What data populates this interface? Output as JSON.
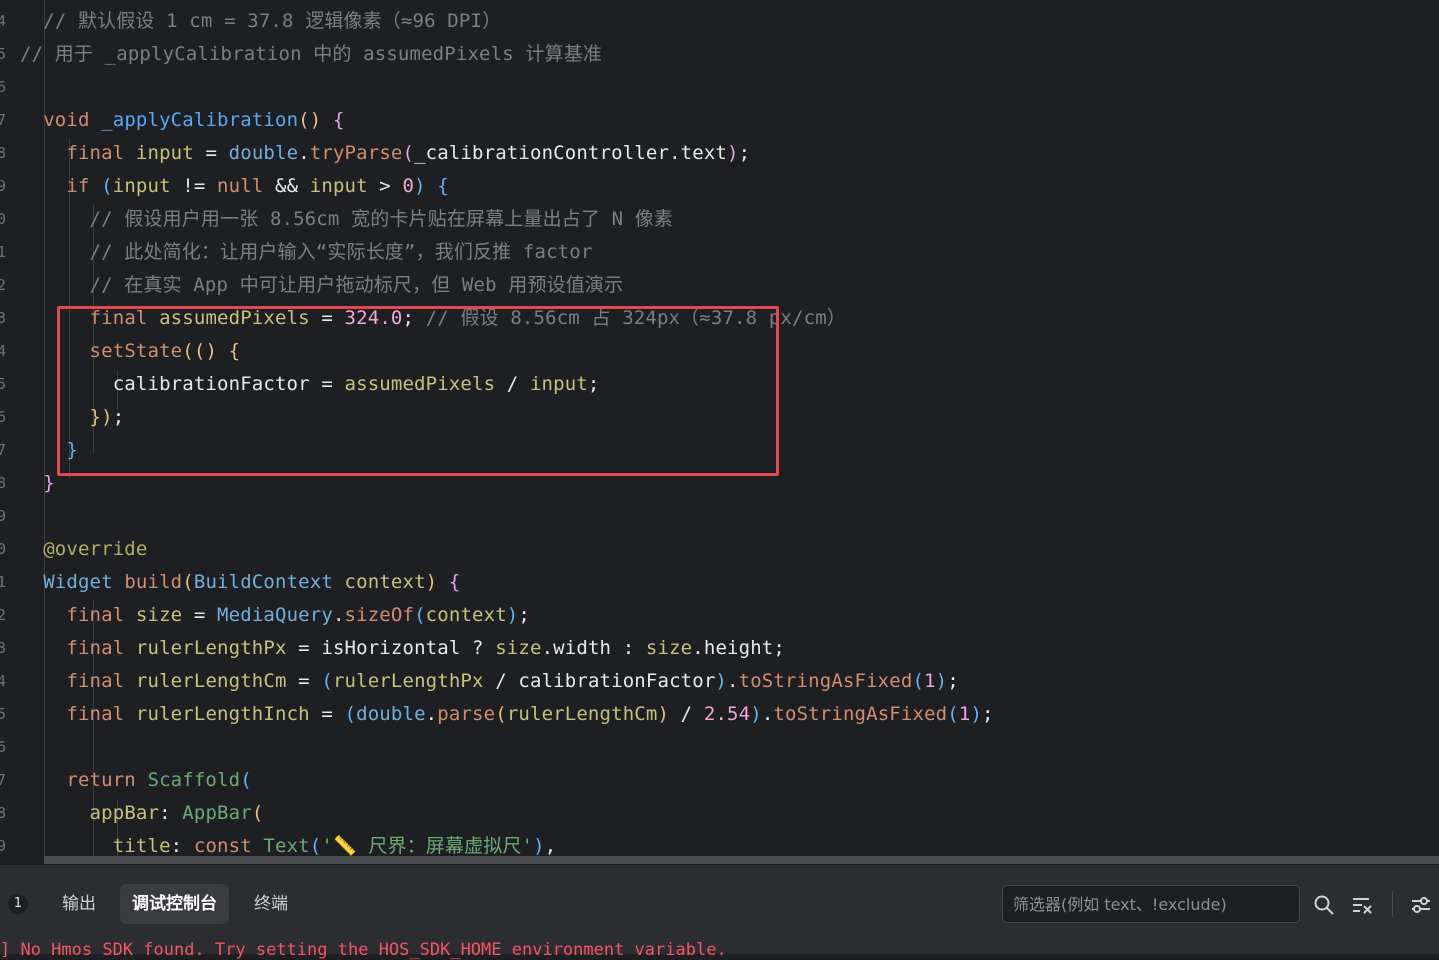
{
  "editor": {
    "gutter_numbers": [
      "4",
      "5",
      "6",
      "7",
      "8",
      "9",
      "0",
      "1",
      "2",
      "3",
      "4",
      "5",
      "6",
      "7",
      "8",
      "9",
      "0",
      "1",
      "2",
      "3",
      "4",
      "5",
      "6",
      "7",
      "8",
      "9"
    ],
    "lines": [
      [
        {
          "t": "  // 默认假设 1 cm = 37.8 逻辑像素（≈96 DPI）",
          "c": "comment"
        }
      ],
      [
        {
          "t": "// 用于 _applyCalibration 中的 assumedPixels 计算基准",
          "c": "comment"
        }
      ],
      [],
      [
        {
          "t": "  ",
          "c": "plain"
        },
        {
          "t": "void ",
          "c": "kw"
        },
        {
          "t": "_applyCalibration",
          "c": "fn"
        },
        {
          "t": "() ",
          "c": "brace3"
        },
        {
          "t": "{",
          "c": "brace1"
        }
      ],
      [
        {
          "t": "    ",
          "c": "plain"
        },
        {
          "t": "final ",
          "c": "kw"
        },
        {
          "t": "input",
          "c": "var"
        },
        {
          "t": " = ",
          "c": "plain"
        },
        {
          "t": "double",
          "c": "type"
        },
        {
          "t": ".",
          "c": "plain"
        },
        {
          "t": "tryParse",
          "c": "kw"
        },
        {
          "t": "(",
          "c": "brace1"
        },
        {
          "t": "_calibrationController",
          "c": "plain"
        },
        {
          "t": ".",
          "c": "plain"
        },
        {
          "t": "text",
          "c": "plain"
        },
        {
          "t": ")",
          "c": "brace1"
        },
        {
          "t": ";",
          "c": "plain"
        }
      ],
      [
        {
          "t": "    ",
          "c": "plain"
        },
        {
          "t": "if ",
          "c": "kw"
        },
        {
          "t": "(",
          "c": "brace2"
        },
        {
          "t": "input",
          "c": "var"
        },
        {
          "t": " != ",
          "c": "plain"
        },
        {
          "t": "null",
          "c": "kw"
        },
        {
          "t": " && ",
          "c": "plain"
        },
        {
          "t": "input",
          "c": "var"
        },
        {
          "t": " > ",
          "c": "plain"
        },
        {
          "t": "0",
          "c": "num"
        },
        {
          "t": ") ",
          "c": "brace2"
        },
        {
          "t": "{",
          "c": "brace2"
        }
      ],
      [
        {
          "t": "      // 假设用户用一张 8.56cm 宽的卡片贴在屏幕上量出占了 N 像素",
          "c": "comment"
        }
      ],
      [
        {
          "t": "      // 此处简化：让用户输入“实际长度”，我们反推 factor",
          "c": "comment"
        }
      ],
      [
        {
          "t": "      // 在真实 App 中可让用户拖动标尺，但 Web 用预设值演示",
          "c": "comment"
        }
      ],
      [
        {
          "t": "      ",
          "c": "plain"
        },
        {
          "t": "final ",
          "c": "kw"
        },
        {
          "t": "assumedPixels",
          "c": "var"
        },
        {
          "t": " = ",
          "c": "plain"
        },
        {
          "t": "324.0",
          "c": "num"
        },
        {
          "t": "; ",
          "c": "plain"
        },
        {
          "t": "// 假设 8.56cm 占 324px（≈37.8 px/cm）",
          "c": "comment"
        }
      ],
      [
        {
          "t": "      ",
          "c": "plain"
        },
        {
          "t": "setState",
          "c": "kw"
        },
        {
          "t": "(() ",
          "c": "brace3"
        },
        {
          "t": "{",
          "c": "brace3"
        }
      ],
      [
        {
          "t": "        ",
          "c": "plain"
        },
        {
          "t": "calibrationFactor",
          "c": "plain"
        },
        {
          "t": " = ",
          "c": "plain"
        },
        {
          "t": "assumedPixels",
          "c": "var"
        },
        {
          "t": " / ",
          "c": "plain"
        },
        {
          "t": "input",
          "c": "var"
        },
        {
          "t": ";",
          "c": "plain"
        }
      ],
      [
        {
          "t": "      ",
          "c": "plain"
        },
        {
          "t": "})",
          "c": "brace3"
        },
        {
          "t": ";",
          "c": "plain"
        }
      ],
      [
        {
          "t": "    ",
          "c": "plain"
        },
        {
          "t": "}",
          "c": "brace2"
        }
      ],
      [
        {
          "t": "  ",
          "c": "plain"
        },
        {
          "t": "}",
          "c": "brace1"
        }
      ],
      [],
      [
        {
          "t": "  ",
          "c": "plain"
        },
        {
          "t": "@override",
          "c": "anno"
        }
      ],
      [
        {
          "t": "  ",
          "c": "plain"
        },
        {
          "t": "Widget ",
          "c": "type"
        },
        {
          "t": "build",
          "c": "kw"
        },
        {
          "t": "(",
          "c": "brace3"
        },
        {
          "t": "BuildContext ",
          "c": "type"
        },
        {
          "t": "context",
          "c": "var"
        },
        {
          "t": ") ",
          "c": "brace3"
        },
        {
          "t": "{",
          "c": "brace1"
        }
      ],
      [
        {
          "t": "    ",
          "c": "plain"
        },
        {
          "t": "final ",
          "c": "kw"
        },
        {
          "t": "size",
          "c": "var"
        },
        {
          "t": " = ",
          "c": "plain"
        },
        {
          "t": "MediaQuery",
          "c": "type"
        },
        {
          "t": ".",
          "c": "plain"
        },
        {
          "t": "sizeOf",
          "c": "kw"
        },
        {
          "t": "(",
          "c": "brace2"
        },
        {
          "t": "context",
          "c": "var"
        },
        {
          "t": ")",
          "c": "brace2"
        },
        {
          "t": ";",
          "c": "plain"
        }
      ],
      [
        {
          "t": "    ",
          "c": "plain"
        },
        {
          "t": "final ",
          "c": "kw"
        },
        {
          "t": "rulerLengthPx",
          "c": "var"
        },
        {
          "t": " = ",
          "c": "plain"
        },
        {
          "t": "isHorizontal",
          "c": "plain"
        },
        {
          "t": " ? ",
          "c": "plain"
        },
        {
          "t": "size",
          "c": "var"
        },
        {
          "t": ".",
          "c": "plain"
        },
        {
          "t": "width",
          "c": "plain"
        },
        {
          "t": " : ",
          "c": "plain"
        },
        {
          "t": "size",
          "c": "var"
        },
        {
          "t": ".",
          "c": "plain"
        },
        {
          "t": "height",
          "c": "plain"
        },
        {
          "t": ";",
          "c": "plain"
        }
      ],
      [
        {
          "t": "    ",
          "c": "plain"
        },
        {
          "t": "final ",
          "c": "kw"
        },
        {
          "t": "rulerLengthCm",
          "c": "var"
        },
        {
          "t": " = ",
          "c": "plain"
        },
        {
          "t": "(",
          "c": "brace2"
        },
        {
          "t": "rulerLengthPx",
          "c": "var"
        },
        {
          "t": " / ",
          "c": "plain"
        },
        {
          "t": "calibrationFactor",
          "c": "plain"
        },
        {
          "t": ")",
          "c": "brace2"
        },
        {
          "t": ".",
          "c": "plain"
        },
        {
          "t": "toStringAsFixed",
          "c": "kw"
        },
        {
          "t": "(",
          "c": "brace2"
        },
        {
          "t": "1",
          "c": "num"
        },
        {
          "t": ")",
          "c": "brace2"
        },
        {
          "t": ";",
          "c": "plain"
        }
      ],
      [
        {
          "t": "    ",
          "c": "plain"
        },
        {
          "t": "final ",
          "c": "kw"
        },
        {
          "t": "rulerLengthInch",
          "c": "var"
        },
        {
          "t": " = ",
          "c": "plain"
        },
        {
          "t": "(",
          "c": "brace2"
        },
        {
          "t": "double",
          "c": "type"
        },
        {
          "t": ".",
          "c": "plain"
        },
        {
          "t": "parse",
          "c": "kw"
        },
        {
          "t": "(",
          "c": "brace3"
        },
        {
          "t": "rulerLengthCm",
          "c": "var"
        },
        {
          "t": ")",
          "c": "brace3"
        },
        {
          "t": " / ",
          "c": "plain"
        },
        {
          "t": "2.54",
          "c": "num"
        },
        {
          "t": ")",
          "c": "brace2"
        },
        {
          "t": ".",
          "c": "plain"
        },
        {
          "t": "toStringAsFixed",
          "c": "kw"
        },
        {
          "t": "(",
          "c": "brace2"
        },
        {
          "t": "1",
          "c": "num"
        },
        {
          "t": ")",
          "c": "brace2"
        },
        {
          "t": ";",
          "c": "plain"
        }
      ],
      [],
      [
        {
          "t": "    ",
          "c": "plain"
        },
        {
          "t": "return ",
          "c": "kw"
        },
        {
          "t": "Scaffold",
          "c": "str"
        },
        {
          "t": "(",
          "c": "brace2"
        }
      ],
      [
        {
          "t": "      ",
          "c": "plain"
        },
        {
          "t": "appBar",
          "c": "var"
        },
        {
          "t": ": ",
          "c": "plain"
        },
        {
          "t": "AppBar",
          "c": "str"
        },
        {
          "t": "(",
          "c": "brace3"
        }
      ],
      [
        {
          "t": "        ",
          "c": "plain"
        },
        {
          "t": "title",
          "c": "var"
        },
        {
          "t": ": ",
          "c": "plain"
        },
        {
          "t": "const ",
          "c": "kw"
        },
        {
          "t": "Text",
          "c": "str"
        },
        {
          "t": "(",
          "c": "brace2"
        },
        {
          "t": "'📏 尺界：屏幕虚拟尺'",
          "c": "str"
        },
        {
          "t": ")",
          "c": "brace2"
        },
        {
          "t": ",",
          "c": "plain"
        }
      ]
    ]
  },
  "panel": {
    "badge": "1",
    "tabs": [
      {
        "label": "输出",
        "active": false
      },
      {
        "label": "调试控制台",
        "active": true
      },
      {
        "label": "终端",
        "active": false
      }
    ],
    "filter_placeholder": "筛选器(例如 text、!exclude)",
    "output_line": "] No Hmos SDK found. Try setting the HOS_SDK_HOME environment variable.",
    "icons": [
      "search-icon",
      "clear-filter-icon",
      "settings-sliders-icon"
    ]
  }
}
